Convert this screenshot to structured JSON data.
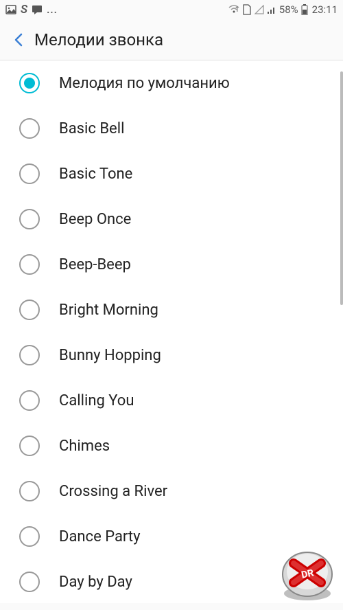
{
  "status_bar": {
    "time": "23:11",
    "battery_text": "58%",
    "left_icons": {
      "gallery": "🖼",
      "s_label": "S",
      "message": "💬",
      "more": "..."
    },
    "right_icons": {
      "wifi": "wifi",
      "sim": "1",
      "no_sim": "◢",
      "signal": ".ıl",
      "battery": "🔋"
    }
  },
  "header": {
    "title": "Мелодии звонка"
  },
  "ringtones": {
    "items": [
      {
        "label": "Мелодия по умолчанию",
        "selected": true
      },
      {
        "label": "Basic Bell",
        "selected": false
      },
      {
        "label": "Basic Tone",
        "selected": false
      },
      {
        "label": "Beep Once",
        "selected": false
      },
      {
        "label": "Beep-Beep",
        "selected": false
      },
      {
        "label": "Bright Morning",
        "selected": false
      },
      {
        "label": "Bunny Hopping",
        "selected": false
      },
      {
        "label": "Calling You",
        "selected": false
      },
      {
        "label": "Chimes",
        "selected": false
      },
      {
        "label": "Crossing a River",
        "selected": false
      },
      {
        "label": "Dance Party",
        "selected": false
      },
      {
        "label": "Day by Day",
        "selected": false
      }
    ]
  }
}
